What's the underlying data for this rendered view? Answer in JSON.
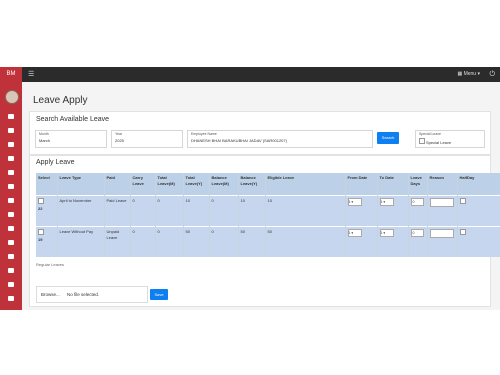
{
  "header": {
    "brand": "BM",
    "menu_label": "Menu",
    "menu_glyph": "☰",
    "power_glyph": "⏻"
  },
  "page": {
    "title": "Leave Apply"
  },
  "search_section": {
    "title": "Search Available Leave",
    "month": {
      "label": "Month",
      "value": "March"
    },
    "year": {
      "label": "Year",
      "value": "2025"
    },
    "employee": {
      "label": "Employee Name",
      "value": "DHANESH BHAI BARAKUBHAI JADAV (SAR001207)"
    },
    "search_button": "Search",
    "special_leave": {
      "label": "Special Leave",
      "checkbox_label": "Special Leave"
    }
  },
  "apply_section": {
    "title": "Apply Leave",
    "columns": [
      "Select",
      "Leave Type",
      "Paid",
      "Carry Leave",
      "Total Leave(M)",
      "Total Leave(Y)",
      "Balance Leave(M)",
      "Balance Leave(Y)",
      "Eligible Leave",
      "From Date",
      "To Date",
      "Leave Days",
      "Reason",
      "HalfDay"
    ],
    "rows": [
      {
        "select_no": "22",
        "leave_type": "April to November",
        "paid": "Paid Leave",
        "carry": "0",
        "total_m": "0",
        "total_y": "10",
        "balance_m": "0",
        "balance_y": "10",
        "eligible": "10",
        "from": "1",
        "to": "1",
        "days": "0"
      },
      {
        "select_no": "19",
        "leave_type": "Leave Without Pay",
        "paid": "Unpaid Leave",
        "carry": "0",
        "total_m": "0",
        "total_y": "50",
        "balance_m": "0",
        "balance_y": "50",
        "eligible": "50",
        "from": "1",
        "to": "1",
        "days": "0"
      }
    ],
    "regular_label": "Regular Leaves",
    "file": {
      "browse": "Browse...",
      "status": "No file selected."
    },
    "save_button": "Save"
  },
  "colors": {
    "sidebar": "#c0323a",
    "topbar": "#2b2b2b",
    "accent": "#0d7ff0",
    "table_header": "#bcd0e8",
    "table_row": "#c5d6ee"
  }
}
